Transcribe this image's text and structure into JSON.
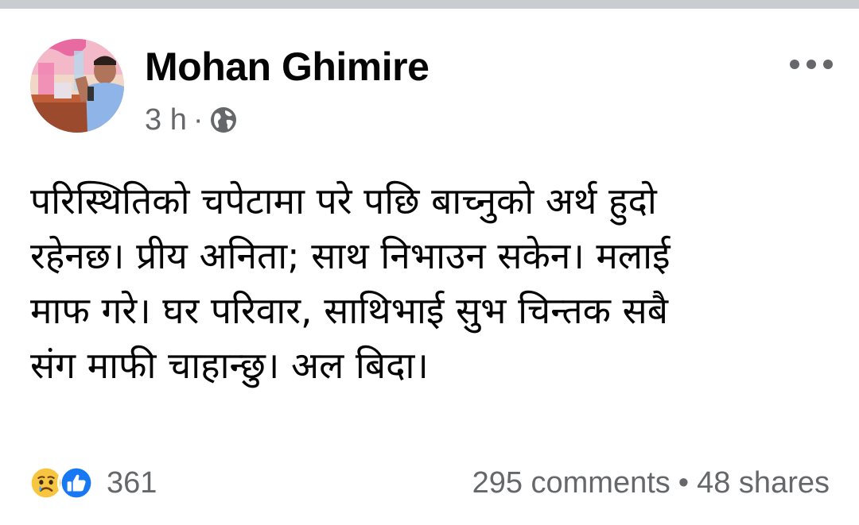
{
  "post": {
    "author": "Mohan Ghimire",
    "time": "3 h",
    "separator": "·",
    "privacy_icon": "globe-icon",
    "more_icon": "more-options-icon",
    "text_lines": [
      "परिस्थितिको चपेटामा परे पछि बाच्नुको अर्थ हुदो",
      "रहेनछ। प्रीय अनिता; साथ निभाउन सकेन। मलाई",
      "माफ गरे।  घर परिवार, साथिभाई सुभ चिन्तक सबै",
      "संग माफी चाहान्छु। अल बिदा।"
    ]
  },
  "footer": {
    "reaction_icons": [
      "sad-reaction-icon",
      "like-reaction-icon"
    ],
    "reaction_count": "361",
    "comments": "295 comments",
    "dot": "•",
    "shares": "48 shares"
  },
  "colors": {
    "text_primary": "#050505",
    "text_secondary": "#65676b",
    "like_blue": "#1877f2",
    "sad_yellow": "#f7c53f",
    "top_bar_gray": "#c9ccd1"
  }
}
